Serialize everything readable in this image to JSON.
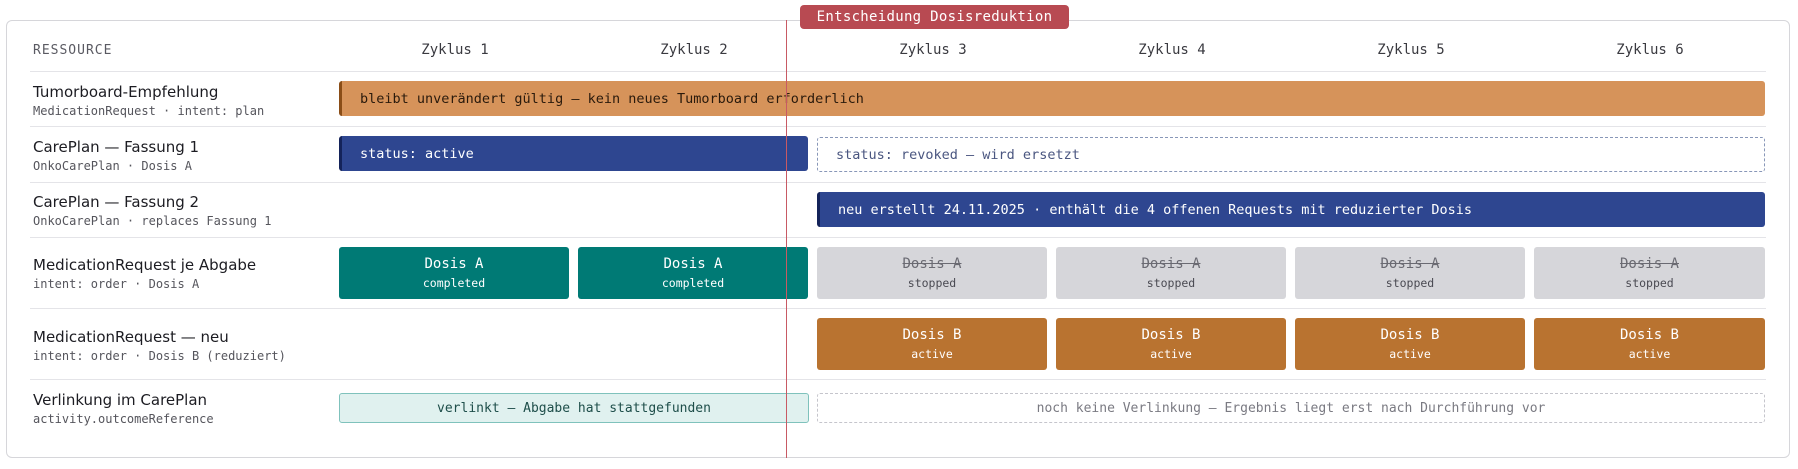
{
  "decision": {
    "label": "Entscheidung Dosisreduktion"
  },
  "header": {
    "resource": "RESSOURCE",
    "cycles": [
      "Zyklus 1",
      "Zyklus 2",
      "Zyklus 3",
      "Zyklus 4",
      "Zyklus 5",
      "Zyklus 6"
    ]
  },
  "rows": [
    {
      "title": "Tumorboard-Empfehlung",
      "subtitle": "MedicationRequest · intent: plan"
    },
    {
      "title": "CarePlan — Fassung 1",
      "subtitle": "OnkoCarePlan · Dosis A"
    },
    {
      "title": "CarePlan — Fassung 2",
      "subtitle": "OnkoCarePlan · replaces Fassung 1"
    },
    {
      "title": "MedicationRequest je Abgabe",
      "subtitle": "intent: order · Dosis A"
    },
    {
      "title": "MedicationRequest — neu",
      "subtitle": "intent: order · Dosis B (reduziert)"
    },
    {
      "title": "Verlinkung im CarePlan",
      "subtitle": "activity.outcomeReference"
    }
  ],
  "bars": {
    "tumorboard": "bleibt unverändert gültig — kein neues Tumorboard erforderlich",
    "careplan1_active": "status: active",
    "careplan1_revoked": "status: revoked — wird ersetzt",
    "careplan2": "neu erstellt 24.11.2025 · enthält die 4 offenen Requests mit reduzierter Dosis"
  },
  "dose_a_cells": [
    {
      "dose": "Dosis A",
      "status": "completed"
    },
    {
      "dose": "Dosis A",
      "status": "completed"
    },
    {
      "dose": "Dosis A",
      "status": "stopped"
    },
    {
      "dose": "Dosis A",
      "status": "stopped"
    },
    {
      "dose": "Dosis A",
      "status": "stopped"
    },
    {
      "dose": "Dosis A",
      "status": "stopped"
    }
  ],
  "dose_b_cells": [
    {
      "dose": "Dosis B",
      "status": "active"
    },
    {
      "dose": "Dosis B",
      "status": "active"
    },
    {
      "dose": "Dosis B",
      "status": "active"
    },
    {
      "dose": "Dosis B",
      "status": "active"
    }
  ],
  "links": {
    "linked": "verlinkt — Abgabe hat stattgefunden",
    "not_linked": "noch keine Verlinkung — Ergebnis liegt erst nach Durchführung vor"
  }
}
